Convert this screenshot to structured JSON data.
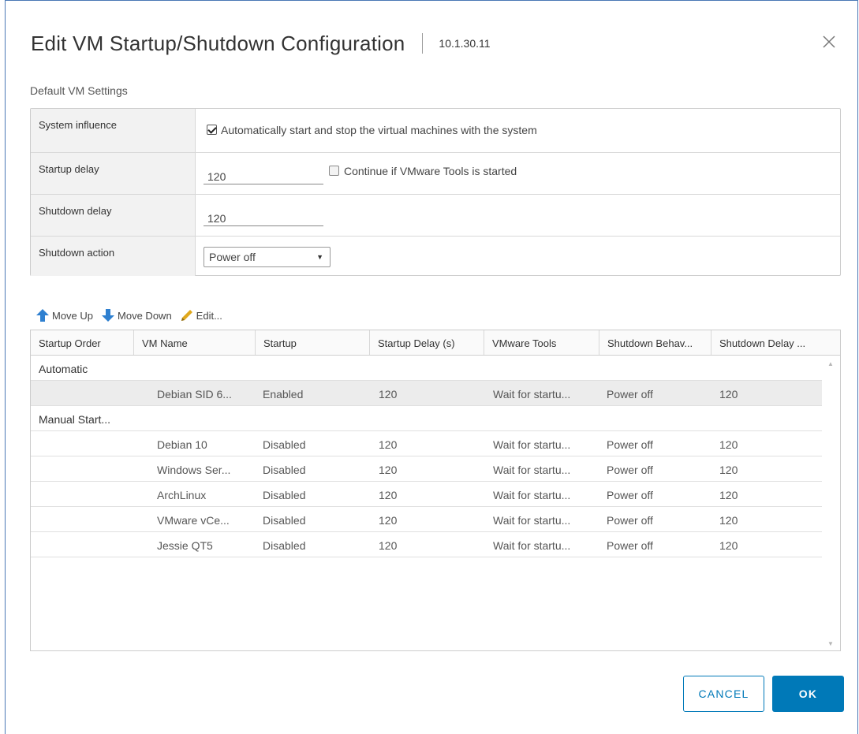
{
  "dialog": {
    "title": "Edit VM Startup/Shutdown Configuration",
    "host": "10.1.30.11",
    "close_icon": "close-icon"
  },
  "defaults": {
    "section_label": "Default VM Settings",
    "system_influence": {
      "label": "System influence",
      "checked": true,
      "text": "Automatically start and stop the virtual machines with the system"
    },
    "startup_delay": {
      "label": "Startup delay",
      "value": "120",
      "continue_checked": false,
      "continue_text": "Continue if VMware Tools is started"
    },
    "shutdown_delay": {
      "label": "Shutdown delay",
      "value": "120"
    },
    "shutdown_action": {
      "label": "Shutdown action",
      "value": "Power off"
    }
  },
  "toolbar": {
    "move_up": "Move Up",
    "move_down": "Move Down",
    "edit": "Edit..."
  },
  "table": {
    "columns": [
      "Startup Order",
      "VM Name",
      "Startup",
      "Startup Delay (s)",
      "VMware Tools",
      "Shutdown Behav...",
      "Shutdown Delay ..."
    ],
    "rows": [
      {
        "type": "group",
        "label": "Automatic"
      },
      {
        "type": "vm",
        "cells": [
          "",
          "Debian SID 6...",
          "Enabled",
          "120",
          "Wait for startu...",
          "Power off",
          "120"
        ],
        "selected": true
      },
      {
        "type": "group",
        "label": "Manual Start..."
      },
      {
        "type": "vm",
        "cells": [
          "",
          "Debian 10",
          "Disabled",
          "120",
          "Wait for startu...",
          "Power off",
          "120"
        ]
      },
      {
        "type": "vm",
        "cells": [
          "",
          "Windows Ser...",
          "Disabled",
          "120",
          "Wait for startu...",
          "Power off",
          "120"
        ]
      },
      {
        "type": "vm",
        "cells": [
          "",
          "ArchLinux",
          "Disabled",
          "120",
          "Wait for startu...",
          "Power off",
          "120"
        ]
      },
      {
        "type": "vm",
        "cells": [
          "",
          "VMware vCe...",
          "Disabled",
          "120",
          "Wait for startu...",
          "Power off",
          "120"
        ]
      },
      {
        "type": "vm",
        "cells": [
          "",
          "Jessie QT5",
          "Disabled",
          "120",
          "Wait for startu...",
          "Power off",
          "120"
        ]
      }
    ]
  },
  "buttons": {
    "cancel": "CANCEL",
    "ok": "OK"
  },
  "colors": {
    "primary": "#0079b8",
    "arrow_icon": "#2f80d0",
    "pencil_icon": "#e0a81c"
  }
}
